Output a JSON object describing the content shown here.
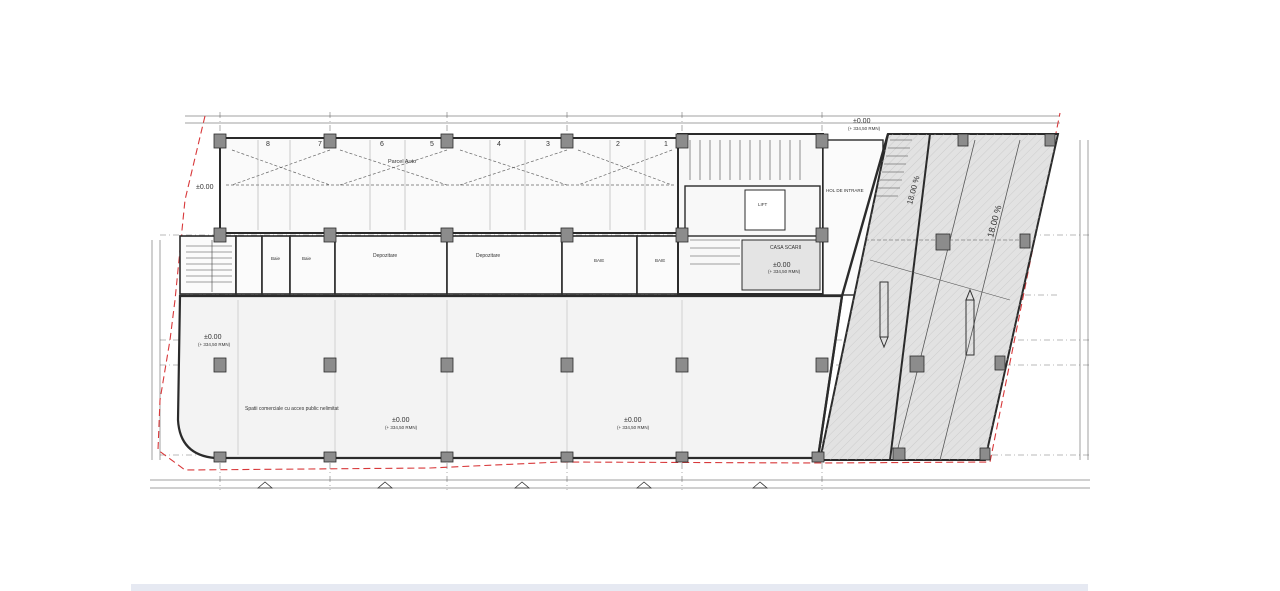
{
  "drawing": {
    "colors": {
      "line": "#2b2b2b",
      "grid": "#555555",
      "boundary": "#d8383a",
      "column": "#8c8c8c",
      "slab": "#e9e9e9",
      "ramp": "#dcdcdc"
    },
    "levels": {
      "top_right": "±0.00",
      "top_right_abs": "(+ 334,50 RMN)",
      "top_left": "±0.00",
      "left": "±0.00",
      "left_abs": "(+ 334,50 RMN)",
      "center": "±0.00",
      "center_abs": "(+ 334,50 RMN)",
      "right": "±0.00",
      "right_abs": "(+ 334,50 RMN)",
      "stair": "±0.00",
      "stair_abs": "(+ 334,50 RMN)"
    },
    "rooms": {
      "parcel": "Parcel Auto",
      "deposit_1": "Depozitare",
      "deposit_2": "Depozitare",
      "bath_1": "Baie",
      "bath_2": "Baie",
      "bath_3": "BAIE",
      "bath_4": "BAIE",
      "stair": "CASA SCARII",
      "hol": "HOL DE INTRARE",
      "lift": "LIFT",
      "commercial": "Spatii comerciale cu acces public nelimitat"
    },
    "slopes": {
      "ramp_left": "18.00 %",
      "ramp_right": "18.00 %"
    },
    "bay_numbers": [
      "8",
      "7",
      "6",
      "5",
      "4",
      "3",
      "2",
      "1"
    ]
  }
}
